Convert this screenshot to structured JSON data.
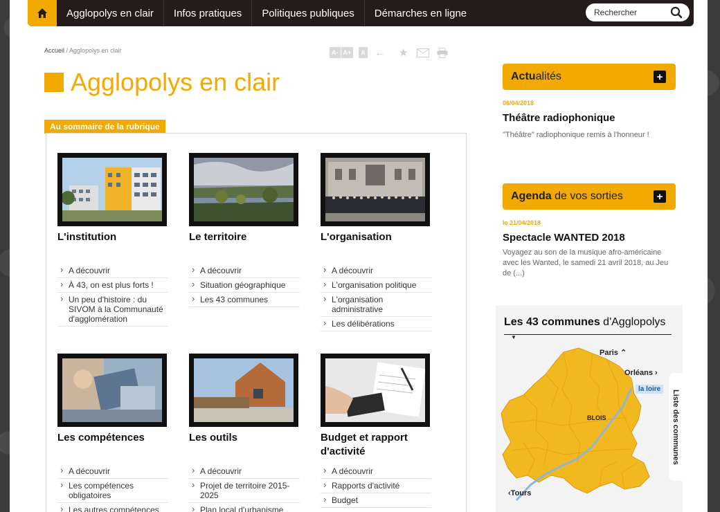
{
  "nav": {
    "items": [
      "Agglopolys en clair",
      "Infos pratiques",
      "Politiques publiques",
      "Démarches en ligne"
    ],
    "search_placeholder": "Rechercher"
  },
  "breadcrumb": {
    "home": "Accueil",
    "current": "Agglopolys en clair"
  },
  "tools": {
    "font_smaller": "A-",
    "font_larger": "A+",
    "font_reset": "A"
  },
  "page_title": "Agglopolys en clair",
  "section_label": "Au sommaire de la rubrique",
  "cards": [
    {
      "title": "L'institution",
      "links": [
        "A découvrir",
        "À 43, on est plus forts !",
        "Un peu d'histoire : du SIVOM à la Communauté d'agglomération"
      ]
    },
    {
      "title": "Le territoire",
      "links": [
        "A découvrir",
        "Situation géographique",
        "Les 43 communes"
      ]
    },
    {
      "title": "L'organisation",
      "links": [
        "A découvrir",
        "L'organisation politique",
        "L'organisation administrative",
        "Les délibérations"
      ]
    },
    {
      "title": "Les compétences",
      "links": [
        "A découvrir",
        "Les compétences obligatoires",
        "Les autres compétences"
      ]
    },
    {
      "title": "Les outils",
      "links": [
        "A découvrir",
        "Projet de territoire 2015-2025",
        "Plan local d'urbanisme"
      ]
    },
    {
      "title": "Budget et rapport d'activité",
      "links": [
        "A découvrir",
        "Rapports d'activité",
        "Budget"
      ]
    }
  ],
  "news": {
    "head_bold": "Actu",
    "head_rest": "alités",
    "date": "06/04/2018",
    "title": "Théâtre radiophonique",
    "text": "\"Théâtre\" radiophonique remis à l'honneur !"
  },
  "agenda": {
    "head_bold": "Agenda",
    "head_rest": " de vos sorties",
    "date": "le 21/04/2018",
    "title": "Spectacle WANTED 2018",
    "text": "Voyagez au son de la musique afro-américaine avec les Wanted, le samedi 21 avril 2018, au Jeu de (...)"
  },
  "map": {
    "title_bold": "Les 43 communes",
    "title_rest": " d'Agglopolys",
    "labels": {
      "paris": "Paris",
      "orleans": "Orléans",
      "loire": "la loire",
      "blois": "BLOIS",
      "tours": "Tours"
    },
    "side_tab": "Liste des communes"
  },
  "colors": {
    "accent": "#f2a900",
    "nav_bg": "#231c1a"
  }
}
